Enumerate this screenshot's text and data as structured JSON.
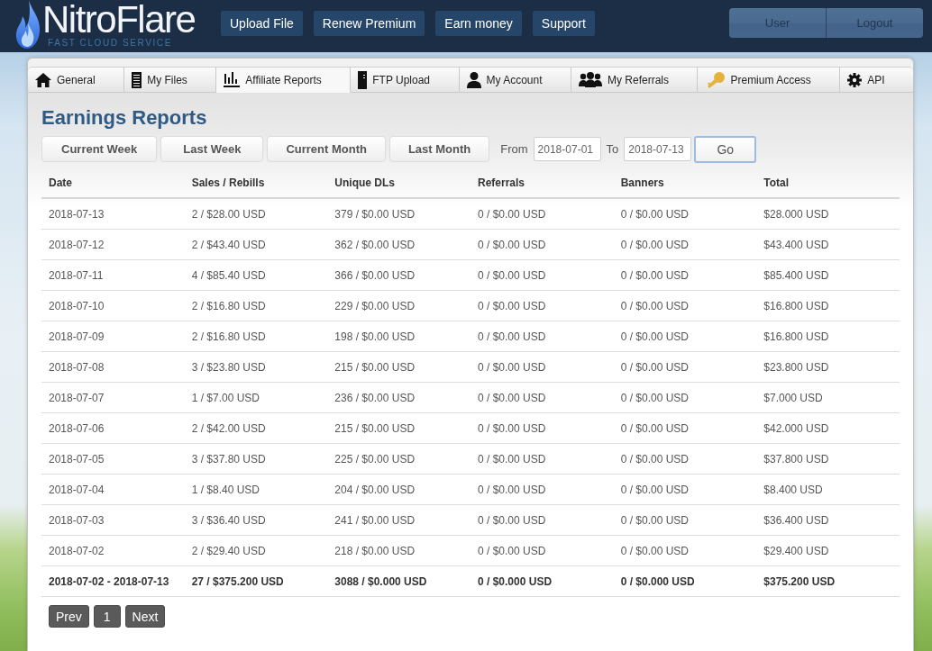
{
  "header": {
    "logo": {
      "name": "NitroFlare",
      "tagline": "FAST CLOUD SERVICE"
    },
    "nav": [
      "Upload File",
      "Renew Premium",
      "Earn money",
      "Support"
    ],
    "user_menu": [
      "User",
      "Logout"
    ]
  },
  "tabs": [
    {
      "label": "General",
      "selected": false
    },
    {
      "label": "My Files",
      "selected": false
    },
    {
      "label": "Affiliate Reports",
      "selected": true
    },
    {
      "label": "FTP Upload",
      "selected": false
    },
    {
      "label": "My Account",
      "selected": false
    },
    {
      "label": "My Referrals",
      "selected": false
    },
    {
      "label": "Premium Access",
      "selected": false
    },
    {
      "label": "API",
      "selected": false
    }
  ],
  "page_title": "Earnings Reports",
  "range_buttons": [
    "Current Week",
    "Last Week",
    "Current Month",
    "Last Month"
  ],
  "filter": {
    "from_label": "From",
    "from_value": "2018-07-01",
    "to_label": "To",
    "to_value": "2018-07-13",
    "go_button": {
      "label": "Go",
      "focused": true
    }
  },
  "table": {
    "columns": [
      "Date",
      "Sales / Rebills",
      "Unique DLs",
      "Referrals",
      "Banners",
      "Total"
    ],
    "rows": [
      [
        "2018-07-13",
        "2 / $28.00 USD",
        "379 / $0.00 USD",
        "0 / $0.00 USD",
        "0 / $0.00 USD",
        "$28.000 USD"
      ],
      [
        "2018-07-12",
        "2 / $43.40 USD",
        "362 / $0.00 USD",
        "0 / $0.00 USD",
        "0 / $0.00 USD",
        "$43.400 USD"
      ],
      [
        "2018-07-11",
        "4 / $85.40 USD",
        "366 / $0.00 USD",
        "0 / $0.00 USD",
        "0 / $0.00 USD",
        "$85.400 USD"
      ],
      [
        "2018-07-10",
        "2 / $16.80 USD",
        "229 / $0.00 USD",
        "0 / $0.00 USD",
        "0 / $0.00 USD",
        "$16.800 USD"
      ],
      [
        "2018-07-09",
        "2 / $16.80 USD",
        "198 / $0.00 USD",
        "0 / $0.00 USD",
        "0 / $0.00 USD",
        "$16.800 USD"
      ],
      [
        "2018-07-08",
        "3 / $23.80 USD",
        "215 / $0.00 USD",
        "0 / $0.00 USD",
        "0 / $0.00 USD",
        "$23.800 USD"
      ],
      [
        "2018-07-07",
        "1 / $7.00 USD",
        "236 / $0.00 USD",
        "0 / $0.00 USD",
        "0 / $0.00 USD",
        "$7.000 USD"
      ],
      [
        "2018-07-06",
        "2 / $42.00 USD",
        "215 / $0.00 USD",
        "0 / $0.00 USD",
        "0 / $0.00 USD",
        "$42.000 USD"
      ],
      [
        "2018-07-05",
        "3 / $37.80 USD",
        "225 / $0.00 USD",
        "0 / $0.00 USD",
        "0 / $0.00 USD",
        "$37.800 USD"
      ],
      [
        "2018-07-04",
        "1 / $8.40 USD",
        "204 / $0.00 USD",
        "0 / $0.00 USD",
        "0 / $0.00 USD",
        "$8.400 USD"
      ],
      [
        "2018-07-03",
        "3 / $36.40 USD",
        "241 / $0.00 USD",
        "0 / $0.00 USD",
        "0 / $0.00 USD",
        "$36.400 USD"
      ],
      [
        "2018-07-02",
        "2 / $29.40 USD",
        "218 / $0.00 USD",
        "0 / $0.00 USD",
        "0 / $0.00 USD",
        "$29.400 USD"
      ]
    ],
    "totals": [
      "2018-07-02 - 2018-07-13",
      "27 / $375.200 USD",
      "3088 / $0.000 USD",
      "0 / $0.000 USD",
      "0 / $0.000 USD",
      "$375.200 USD"
    ]
  },
  "pagination": [
    "Prev",
    "1",
    "Next"
  ]
}
